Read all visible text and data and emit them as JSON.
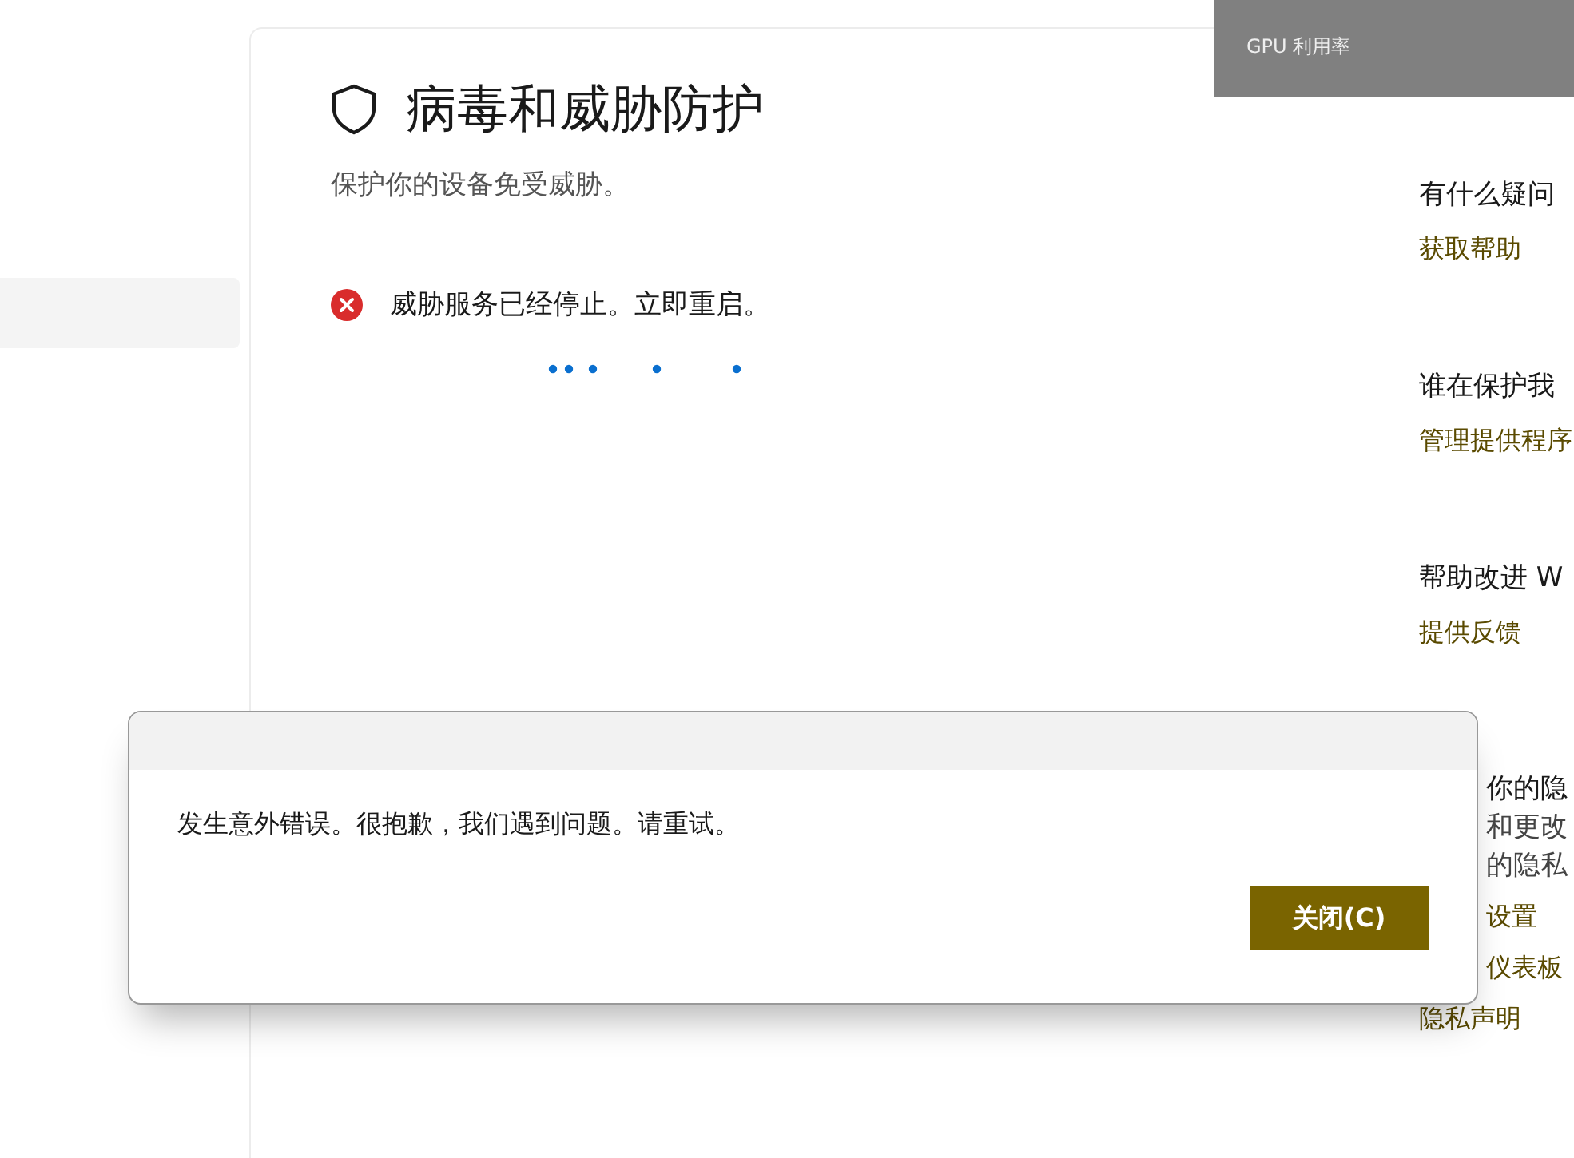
{
  "overlay": {
    "label": "GPU 利用率"
  },
  "page": {
    "title": "病毒和威胁防护",
    "subtitle": "保护你的设备免受威胁。",
    "alert": {
      "text": "威胁服务已经停止。立即重启。"
    }
  },
  "side_panel": {
    "sections": [
      {
        "heading": "有什么疑问",
        "links": [
          "获取帮助"
        ]
      },
      {
        "heading": "谁在保护我",
        "links": [
          "管理提供程序"
        ]
      },
      {
        "heading": "帮助改进 W",
        "links": [
          "提供反馈"
        ]
      },
      {
        "heading": "你的隐",
        "lines": [
          "和更改",
          "的隐私"
        ],
        "links": [
          "设置",
          "仪表板",
          "隐私声明"
        ]
      }
    ]
  },
  "dialog": {
    "message": "发生意外错误。很抱歉，我们遇到问题。请重试。",
    "buttons": [
      "关闭(C)"
    ]
  }
}
